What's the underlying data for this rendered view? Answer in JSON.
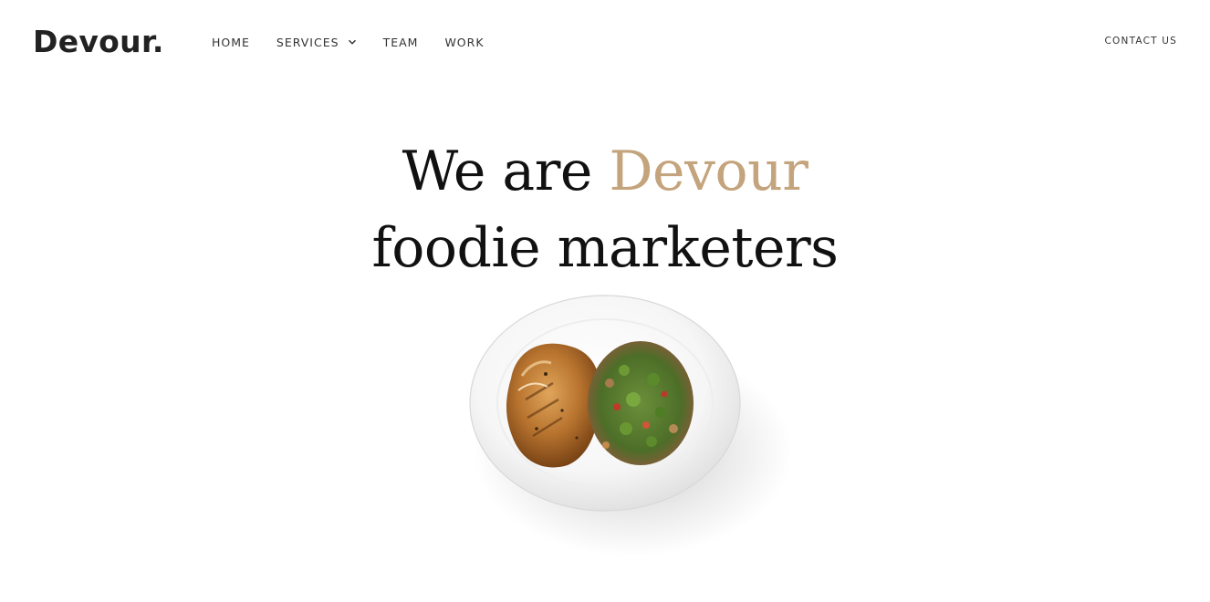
{
  "brand": {
    "logo": "Devour."
  },
  "nav": {
    "items": [
      {
        "label": "HOME"
      },
      {
        "label": "SERVICES"
      },
      {
        "label": "TEAM"
      },
      {
        "label": "WORK"
      }
    ],
    "contact_label": "CONTACT US"
  },
  "hero": {
    "line1_prefix": "We are ",
    "line1_accent": "Devour",
    "line2": "foodie marketers",
    "image_alt": "plate of roasted chicken with quinoa salad"
  },
  "colors": {
    "accent": "#c4a47c",
    "text": "#111111",
    "background": "#ffffff"
  }
}
